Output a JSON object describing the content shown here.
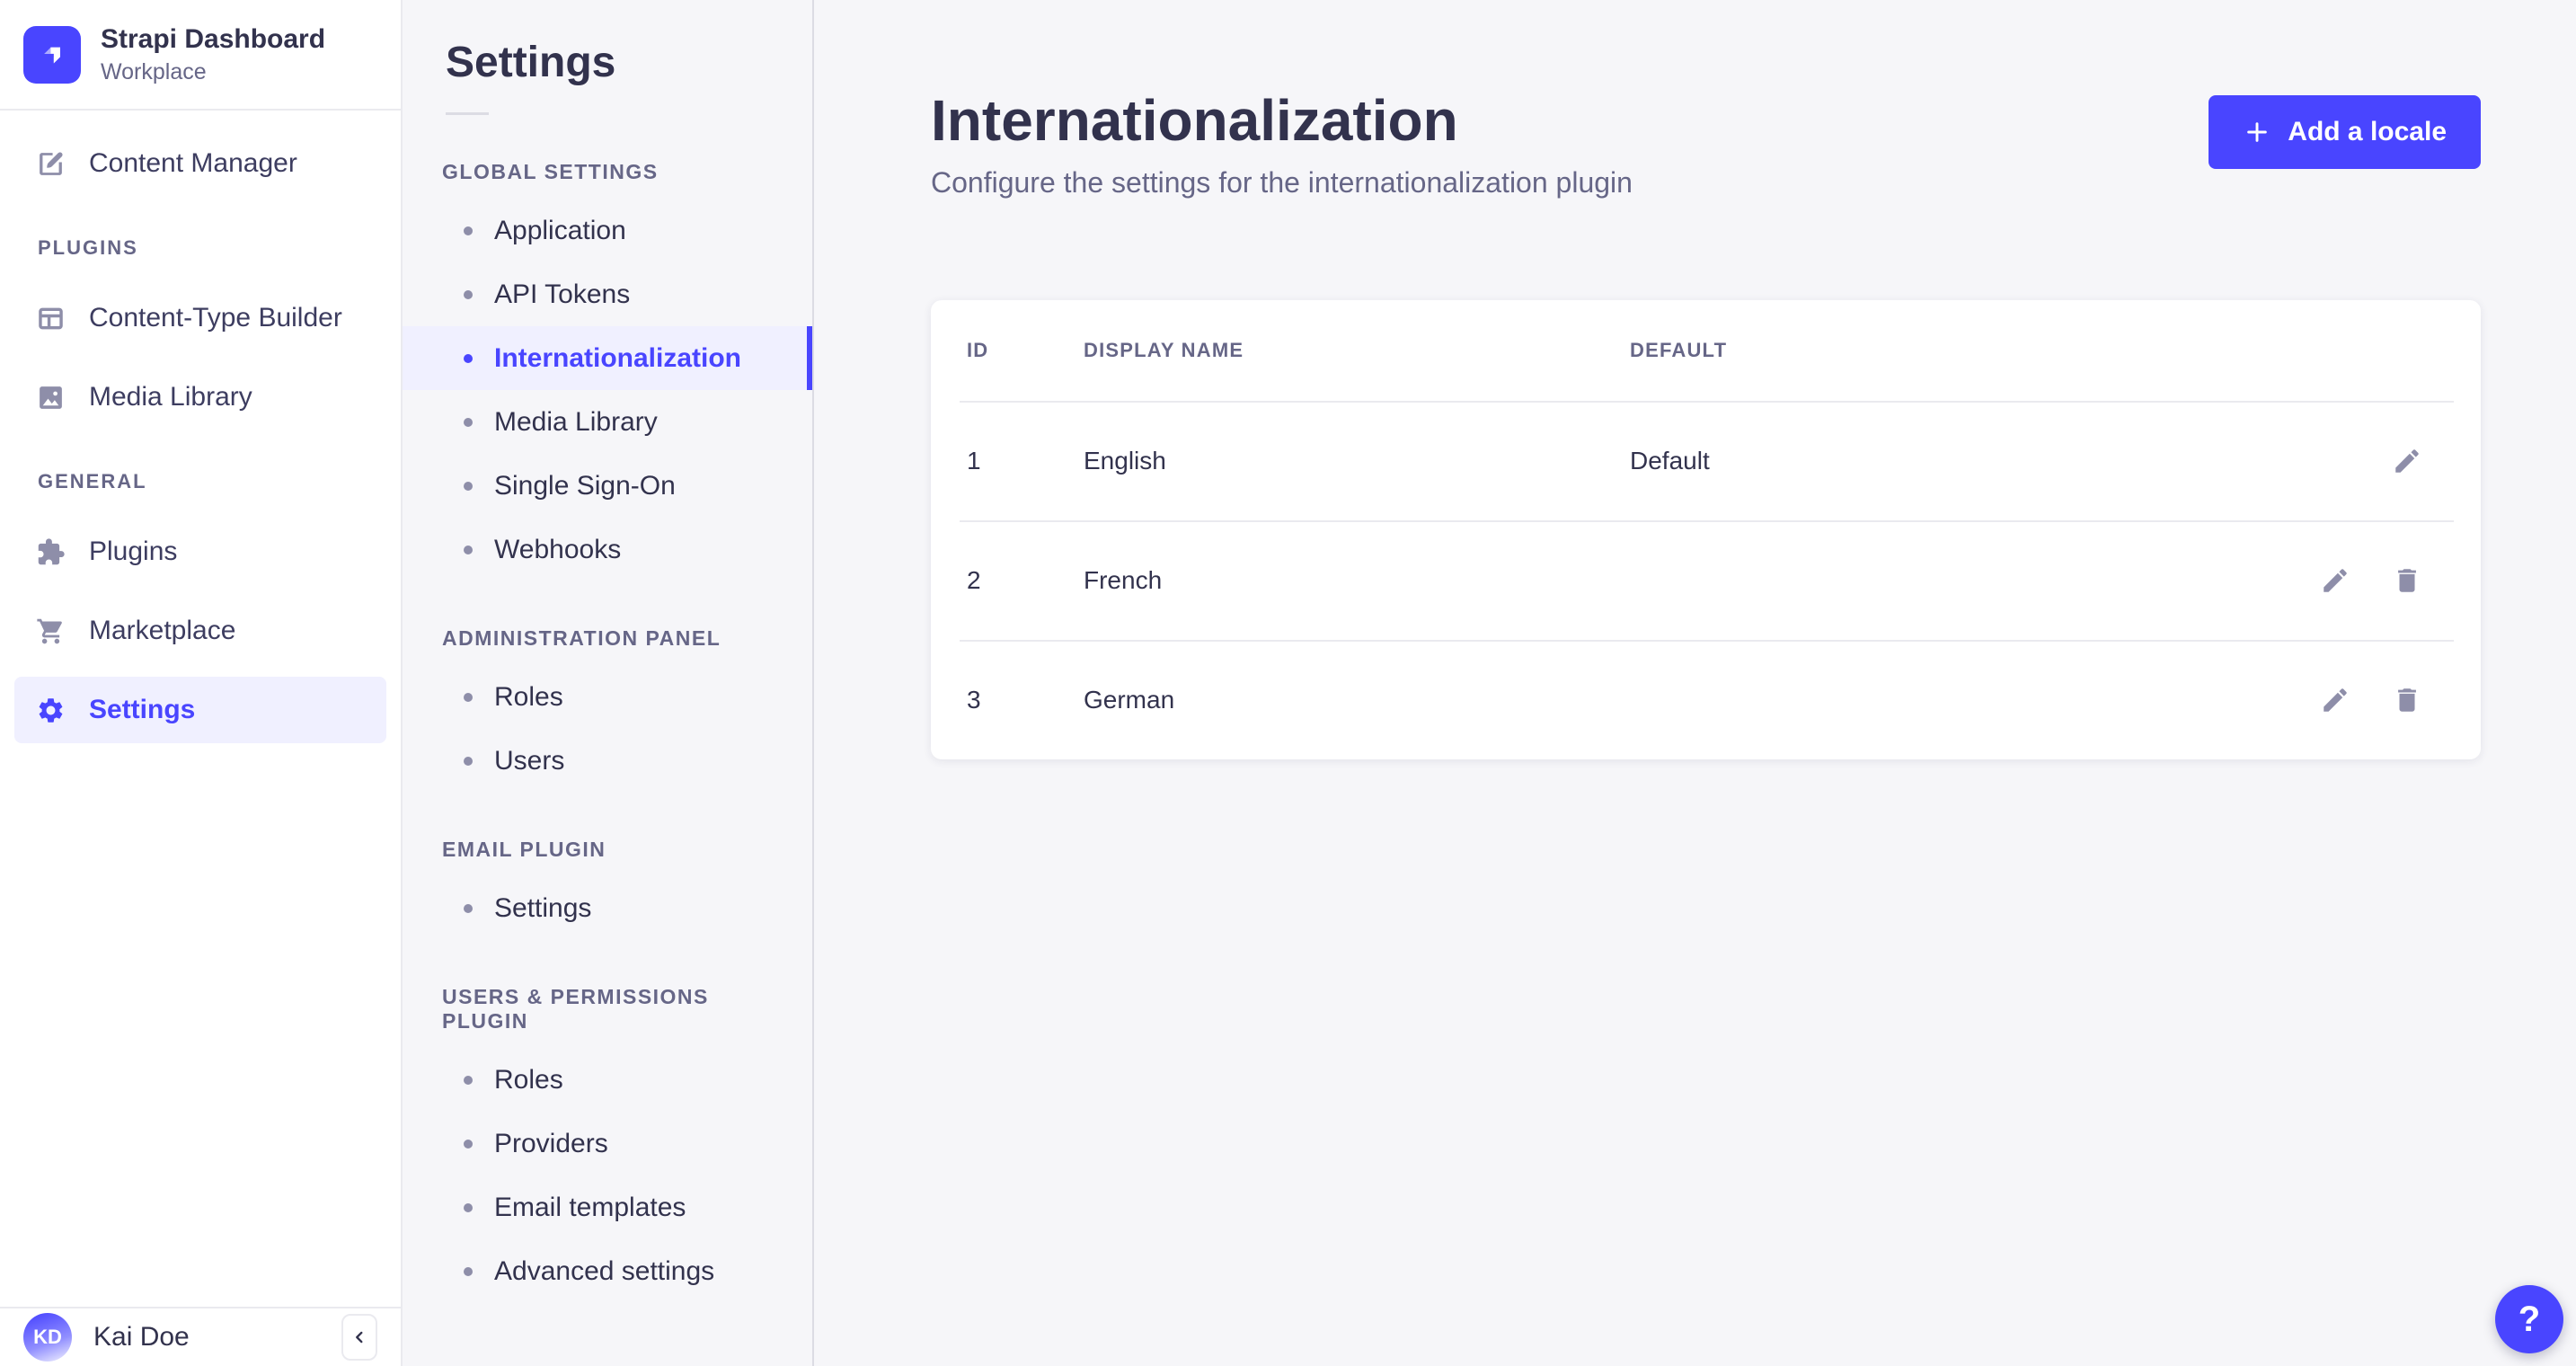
{
  "brand": {
    "name": "Strapi Dashboard",
    "workplace": "Workplace"
  },
  "colors": {
    "accent": "#4945FF",
    "accent_bg": "#F0F0FF",
    "text_dark": "#32324D",
    "text_muted": "#666687",
    "icon_gray": "#8E8EA9",
    "border": "#EAEAEF",
    "page_bg": "#F6F6F9"
  },
  "sidebar": {
    "top_items": [
      {
        "label": "Content Manager",
        "icon": "content-manager-icon",
        "active": false
      }
    ],
    "sections": [
      {
        "label": "PLUGINS",
        "items": [
          {
            "label": "Content-Type Builder",
            "icon": "content-type-builder-icon",
            "active": false
          },
          {
            "label": "Media Library",
            "icon": "media-library-icon",
            "active": false
          }
        ]
      },
      {
        "label": "GENERAL",
        "items": [
          {
            "label": "Plugins",
            "icon": "plugins-icon",
            "active": false
          },
          {
            "label": "Marketplace",
            "icon": "marketplace-icon",
            "active": false
          },
          {
            "label": "Settings",
            "icon": "settings-icon",
            "active": true
          }
        ]
      }
    ],
    "user": {
      "initials": "KD",
      "name": "Kai Doe"
    }
  },
  "subnav": {
    "title": "Settings",
    "sections": [
      {
        "label": "GLOBAL SETTINGS",
        "items": [
          {
            "label": "Application",
            "active": false
          },
          {
            "label": "API Tokens",
            "active": false
          },
          {
            "label": "Internationalization",
            "active": true
          },
          {
            "label": "Media Library",
            "active": false
          },
          {
            "label": "Single Sign-On",
            "active": false
          },
          {
            "label": "Webhooks",
            "active": false
          }
        ]
      },
      {
        "label": "ADMINISTRATION PANEL",
        "items": [
          {
            "label": "Roles",
            "active": false
          },
          {
            "label": "Users",
            "active": false
          }
        ]
      },
      {
        "label": "EMAIL PLUGIN",
        "items": [
          {
            "label": "Settings",
            "active": false
          }
        ]
      },
      {
        "label": "USERS & PERMISSIONS PLUGIN",
        "items": [
          {
            "label": "Roles",
            "active": false
          },
          {
            "label": "Providers",
            "active": false
          },
          {
            "label": "Email templates",
            "active": false
          },
          {
            "label": "Advanced settings",
            "active": false
          }
        ]
      }
    ]
  },
  "main": {
    "title": "Internationalization",
    "subtitle": "Configure the settings for the internationalization plugin",
    "add_button_label": "Add a locale",
    "table": {
      "headers": {
        "id": "ID",
        "display_name": "DISPLAY NAME",
        "default": "DEFAULT"
      },
      "rows": [
        {
          "id": "1",
          "display_name": "English",
          "default": "Default",
          "actions": [
            "edit"
          ]
        },
        {
          "id": "2",
          "display_name": "French",
          "default": "",
          "actions": [
            "edit",
            "delete"
          ]
        },
        {
          "id": "3",
          "display_name": "German",
          "default": "",
          "actions": [
            "edit",
            "delete"
          ]
        }
      ]
    },
    "help_label": "?"
  }
}
